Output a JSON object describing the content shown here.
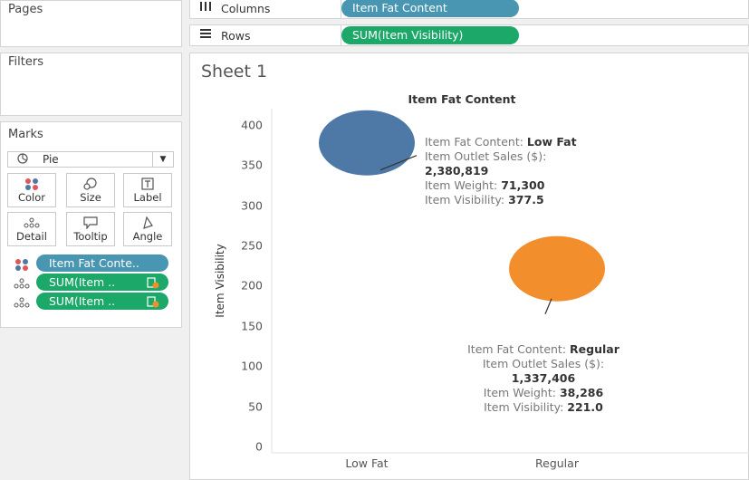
{
  "panels": {
    "pages_title": "Pages",
    "filters_title": "Filters",
    "marks_title": "Marks"
  },
  "shelves": {
    "columns": {
      "label": "Columns",
      "icon": "columns-icon",
      "pill": "Item Fat Content"
    },
    "rows": {
      "label": "Rows",
      "icon": "rows-icon",
      "pill": "SUM(Item Visibility)"
    }
  },
  "marks": {
    "type": "Pie",
    "buttons": {
      "color": "Color",
      "size": "Size",
      "label": "Label",
      "detail": "Detail",
      "tooltip": "Tooltip",
      "angle": "Angle"
    },
    "pills": [
      {
        "icon": "color-dots-icon",
        "text": "Item Fat Conte..",
        "color": "#4996b2"
      },
      {
        "icon": "detail-dots-icon",
        "text": "SUM(Item ..",
        "color": "#1ba868"
      },
      {
        "icon": "detail-dots-icon",
        "text": "SUM(Item ..",
        "color": "#1ba868"
      }
    ]
  },
  "sheet": {
    "title": "Sheet 1"
  },
  "chart_data": {
    "type": "scatter",
    "title": "Item Fat Content",
    "ylabel": "Item Visibility",
    "xlabel": "",
    "categories": [
      "Low Fat",
      "Regular"
    ],
    "values": [
      377.5,
      221.0
    ],
    "colors": [
      "#4e79a7",
      "#f28e2b"
    ],
    "ylim": [
      0,
      420
    ],
    "yticks": [
      "0",
      "50",
      "100",
      "150",
      "200",
      "250",
      "300",
      "350",
      "400"
    ],
    "grid": false,
    "labels": [
      {
        "fat_label": "Item Fat Content:",
        "fat_value": "Low Fat",
        "sales_label": "Item Outlet Sales ($):",
        "sales_value": "2,380,819",
        "weight_label": "Item Weight:",
        "weight_value": "71,300",
        "vis_label": "Item Visibility:",
        "vis_value": "377.5"
      },
      {
        "fat_label": "Item Fat Content:",
        "fat_value": "Regular",
        "sales_label": "Item Outlet Sales ($):",
        "sales_value": "1,337,406",
        "weight_label": "Item Weight:",
        "weight_value": "38,286",
        "vis_label": "Item Visibility:",
        "vis_value": "221.0"
      }
    ]
  }
}
